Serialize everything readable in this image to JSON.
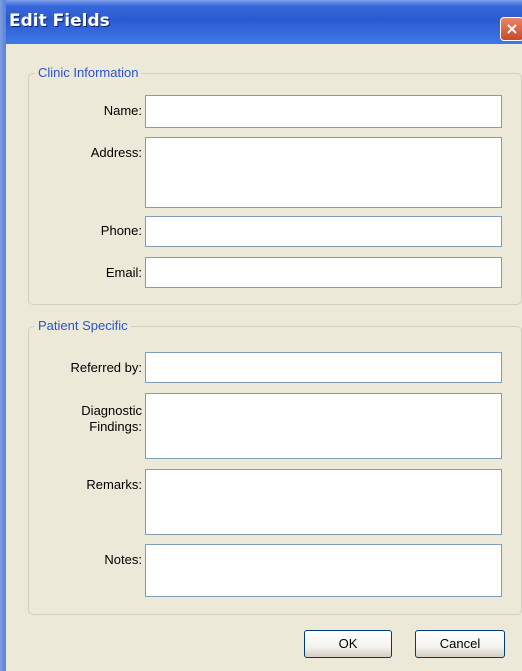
{
  "window": {
    "title": "Edit Fields",
    "close_glyph": "×"
  },
  "clinic": {
    "legend": "Clinic Information",
    "name_label": "Name:",
    "address_label": "Address:",
    "phone_label": "Phone:",
    "email_label": "Email:",
    "name_value": "",
    "address_value": "",
    "phone_value": "",
    "email_value": ""
  },
  "patient": {
    "legend": "Patient Specific",
    "referred_label": "Referred by:",
    "diagnostic_label_1": "Diagnostic",
    "diagnostic_label_2": "Findings:",
    "remarks_label": "Remarks:",
    "notes_label": "Notes:",
    "referred_value": "",
    "diagnostic_value": "",
    "remarks_value": "",
    "notes_value": ""
  },
  "buttons": {
    "ok": "OK",
    "cancel": "Cancel"
  },
  "colors": {
    "titlebar": "#2b5ad0",
    "legend_text": "#2b54c9",
    "field_border": "#7f9db9",
    "dialog_bg": "#ece9d8"
  },
  "icons": {
    "close": "close-icon"
  }
}
